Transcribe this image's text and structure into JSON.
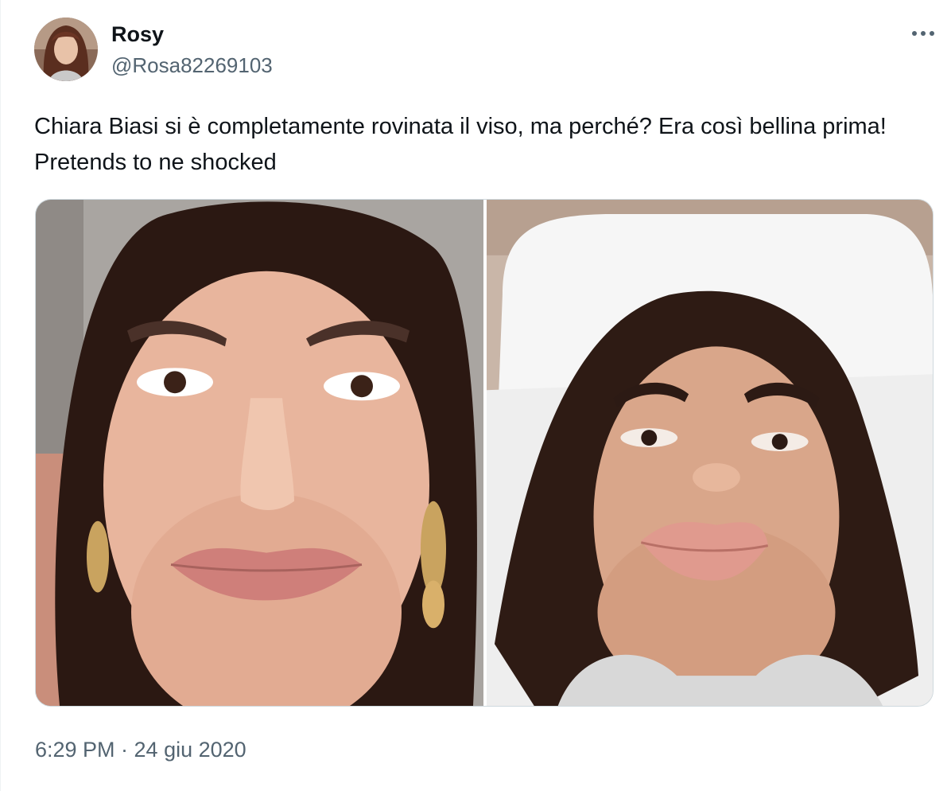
{
  "tweet": {
    "author": {
      "display_name": "Rosy",
      "handle": "@Rosa82269103"
    },
    "text": "Chiara Biasi si è completamente rovinata il viso, ma perché? Era così bellina prima! Pretends to ne shocked",
    "timestamp": "6:29 PM · 24 giu 2020",
    "more_icon": "more-horizontal-icon",
    "media_count": 2
  },
  "colors": {
    "text_primary": "#0f1419",
    "text_secondary": "#536471",
    "border": "#cfd9de"
  }
}
